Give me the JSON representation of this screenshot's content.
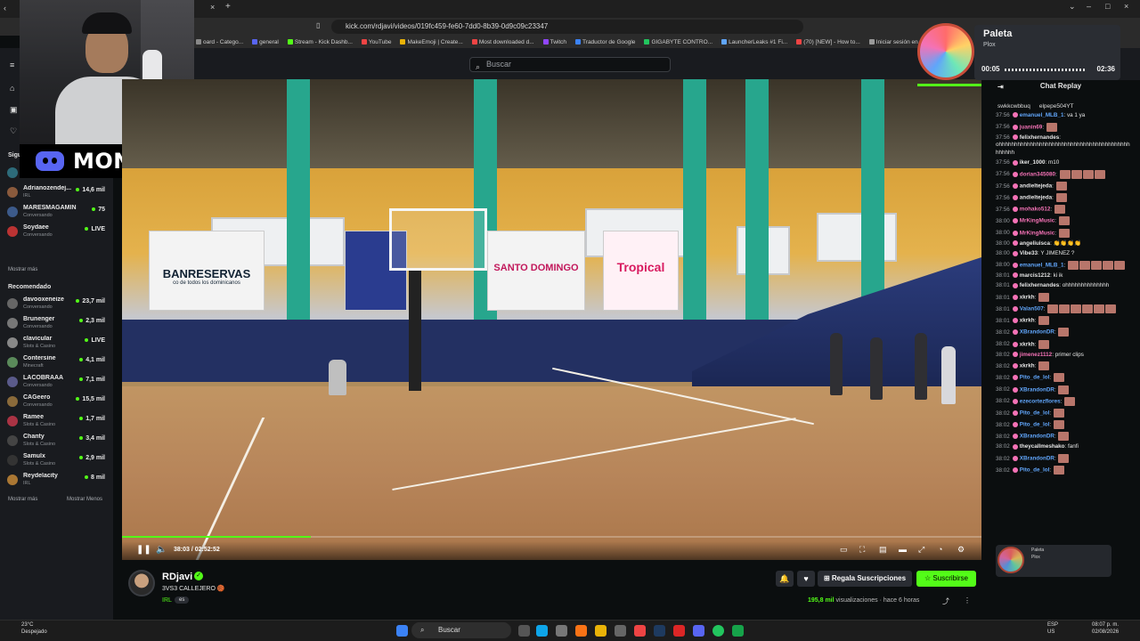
{
  "browser": {
    "url": "kick.com/rdjavi/videos/019fc459-fe60-7dd0-8b39-0d9c09c23347",
    "bookmarks": [
      "oard - Catego...",
      "general",
      "Stream - Kick Dashb...",
      "YouTube",
      "MakeEmoji | Create...",
      "Most downloaded d...",
      "Twitch",
      "Traductor de Google",
      "GIGABYTE CONTRO...",
      "LauncherLeaks #1 Fi...",
      "(70) [NEW] - How to...",
      "Iniciar sesión en Flickr",
      "KickBot"
    ]
  },
  "header": {
    "search_placeholder": "Buscar"
  },
  "overlay": {
    "discord_name": "MONO_TJ"
  },
  "sidebar": {
    "following_label": "Siguiendo",
    "following": [
      {
        "name": "W",
        "category": "S",
        "viewers": "",
        "live": false,
        "color": "#2d6b7a"
      },
      {
        "name": "Adrianozendej...",
        "category": "IRL",
        "viewers": "14,6 mil",
        "live": true,
        "color": "#8a5a3c"
      },
      {
        "name": "MARESMAGAMIN",
        "category": "Conversando",
        "viewers": "75",
        "live": true,
        "color": "#3c5a8a"
      },
      {
        "name": "Soydaee",
        "category": "Conversando",
        "viewers": "LIVE",
        "live": true,
        "color": "#b33"
      }
    ],
    "show_more": "Mostrar más",
    "recommended_label": "Recomendado",
    "recommended": [
      {
        "name": "davooxeneize",
        "category": "Conversando",
        "viewers": "23,7 mil",
        "color": "#666"
      },
      {
        "name": "Brunenger",
        "category": "Conversando",
        "viewers": "2,3 mil",
        "color": "#777"
      },
      {
        "name": "clavicular",
        "category": "Slots & Casino",
        "viewers": "LIVE",
        "color": "#888"
      },
      {
        "name": "Contersine",
        "category": "Minecraft",
        "viewers": "4,1 mil",
        "color": "#5a8a5a"
      },
      {
        "name": "LACOBRAAA",
        "category": "Conversando",
        "viewers": "7,1 mil",
        "color": "#5a5a8a"
      },
      {
        "name": "CAGeero",
        "category": "Conversando",
        "viewers": "15,5 mil",
        "color": "#8a6a3a"
      },
      {
        "name": "Ramee",
        "category": "Slots & Casino",
        "viewers": "1,7 mil",
        "color": "#aa3344"
      },
      {
        "name": "Chanty",
        "category": "Slots & Casino",
        "viewers": "3,4 mil",
        "color": "#444"
      },
      {
        "name": "Samulx",
        "category": "Slots & Casino",
        "viewers": "2,9 mil",
        "color": "#333"
      },
      {
        "name": "Reydelacity",
        "category": "IRL",
        "viewers": "8 mil",
        "color": "#aa7733"
      }
    ],
    "show_more_bottom": "Mostrar más",
    "show_less": "Mostrar Menos"
  },
  "video": {
    "time": "38:03 / 02:52:52",
    "progress": 0.22,
    "banners": [
      "BANRESERVAS",
      "co de todos los dominicanos",
      "SANTO DOMINGO",
      "Tropical"
    ]
  },
  "music": {
    "title": "Paleta",
    "artist": "Plox",
    "elapsed": "00:05",
    "total": "02:36"
  },
  "chat": {
    "title": "Chat Replay",
    "top_users": [
      "swkkcwbbuq",
      "elpepe504YT"
    ],
    "messages": [
      {
        "ts": "37:56",
        "user": "emanuel_MLB_1",
        "text": "va 1 ya",
        "color": "#60a5fa",
        "emotes": 0
      },
      {
        "ts": "37:56",
        "user": "juanin69",
        "text": "",
        "color": "#f472b6",
        "emotes": 1
      },
      {
        "ts": "37:56",
        "user": "felixhernandes",
        "text": "ohhhhhhhhhhhhhhhhhhhhhhhhhhhhhhhhhhhhhhhhhhhhhhhh",
        "color": "#e6e6e6",
        "emotes": 0
      },
      {
        "ts": "37:56",
        "user": "iker_1000",
        "text": "m10",
        "color": "#e6e6e6",
        "emotes": 0
      },
      {
        "ts": "37:56",
        "user": "dorian345080",
        "text": "",
        "color": "#f472b6",
        "emotes": 4
      },
      {
        "ts": "37:56",
        "user": "andieltejeda",
        "text": "",
        "color": "#e6e6e6",
        "emotes": 1
      },
      {
        "ts": "37:56",
        "user": "andieltejeda",
        "text": "",
        "color": "#e6e6e6",
        "emotes": 1
      },
      {
        "ts": "37:56",
        "user": "mohako512",
        "text": "",
        "color": "#f472b6",
        "emotes": 1
      },
      {
        "ts": "38:00",
        "user": "MrKingMusic",
        "text": "",
        "color": "#f472b6",
        "emotes": 1
      },
      {
        "ts": "38:00",
        "user": "MrKingMusic",
        "text": "",
        "color": "#f472b6",
        "emotes": 1
      },
      {
        "ts": "38:00",
        "user": "angeliuisca",
        "text": "👏👏👏👏",
        "color": "#e6e6e6",
        "emotes": 0
      },
      {
        "ts": "38:00",
        "user": "Vibe33",
        "text": "Y JIMENEZ ?",
        "color": "#e6e6e6",
        "emotes": 0
      },
      {
        "ts": "38:00",
        "user": "emanuel_MLB_1",
        "text": "",
        "color": "#60a5fa",
        "emotes": 5
      },
      {
        "ts": "38:01",
        "user": "marcis1212",
        "text": "ki ik",
        "color": "#e6e6e6",
        "emotes": 0
      },
      {
        "ts": "38:01",
        "user": "felixhernandes",
        "text": "ohhhhhhhhhhhhhh",
        "color": "#e6e6e6",
        "emotes": 0
      },
      {
        "ts": "38:01",
        "user": "xkrkh",
        "text": "",
        "color": "#e6e6e6",
        "emotes": 1
      },
      {
        "ts": "38:01",
        "user": "Valan507",
        "text": "",
        "color": "#60a5fa",
        "emotes": 6
      },
      {
        "ts": "38:01",
        "user": "xkrkh",
        "text": "",
        "color": "#e6e6e6",
        "emotes": 1
      },
      {
        "ts": "38:02",
        "user": "XBrandonDR",
        "text": "",
        "color": "#60a5fa",
        "emotes": 1
      },
      {
        "ts": "38:02",
        "user": "xkrkh",
        "text": "",
        "color": "#e6e6e6",
        "emotes": 1
      },
      {
        "ts": "38:02",
        "user": "jimenez1112",
        "text": "primer clips",
        "color": "#f472b6",
        "emotes": 0
      },
      {
        "ts": "38:02",
        "user": "xkrkh",
        "text": "",
        "color": "#e6e6e6",
        "emotes": 1
      },
      {
        "ts": "38:02",
        "user": "Pito_de_lol",
        "text": "",
        "color": "#60a5fa",
        "emotes": 1
      },
      {
        "ts": "38:02",
        "user": "XBrandonDR",
        "text": "",
        "color": "#60a5fa",
        "emotes": 1
      },
      {
        "ts": "38:02",
        "user": "ezecortezflores",
        "text": "",
        "color": "#60a5fa",
        "emotes": 1
      },
      {
        "ts": "38:02",
        "user": "Pito_de_lol",
        "text": "",
        "color": "#60a5fa",
        "emotes": 1
      },
      {
        "ts": "38:02",
        "user": "Pito_de_lol",
        "text": "",
        "color": "#60a5fa",
        "emotes": 1
      },
      {
        "ts": "38:02",
        "user": "XBrandonDR",
        "text": "",
        "color": "#60a5fa",
        "emotes": 1
      },
      {
        "ts": "38:02",
        "user": "theycallmeshako",
        "text": "fanfi",
        "color": "#e6e6e6",
        "emotes": 0
      },
      {
        "ts": "38:02",
        "user": "XBrandonDR",
        "text": "",
        "color": "#60a5fa",
        "emotes": 1
      },
      {
        "ts": "38:02",
        "user": "Pito_de_lol",
        "text": "",
        "color": "#60a5fa",
        "emotes": 1
      }
    ],
    "mini_player": {
      "title": "Paleta",
      "artist": "Plox"
    }
  },
  "channel": {
    "name": "RDjavi",
    "title": "3VS3 CALLEJERO 🏀",
    "category": "IRL",
    "language": "es",
    "gift_label": "Regala Suscripciones",
    "subscribe_label": "Suscribirse",
    "views": "195,8 mil",
    "views_suffix": "visualizaciones",
    "age": "hace 6 horas"
  },
  "taskbar": {
    "weather_temp": "23°C",
    "weather_desc": "Despejado",
    "search": "Buscar",
    "lang_top": "ESP",
    "lang_bottom": "US",
    "time": "08:07 p. m.",
    "date": "02/08/2026"
  },
  "colors": {
    "accent": "#53fc18",
    "chat_pink": "#f472b6",
    "chat_blue": "#60a5fa"
  }
}
